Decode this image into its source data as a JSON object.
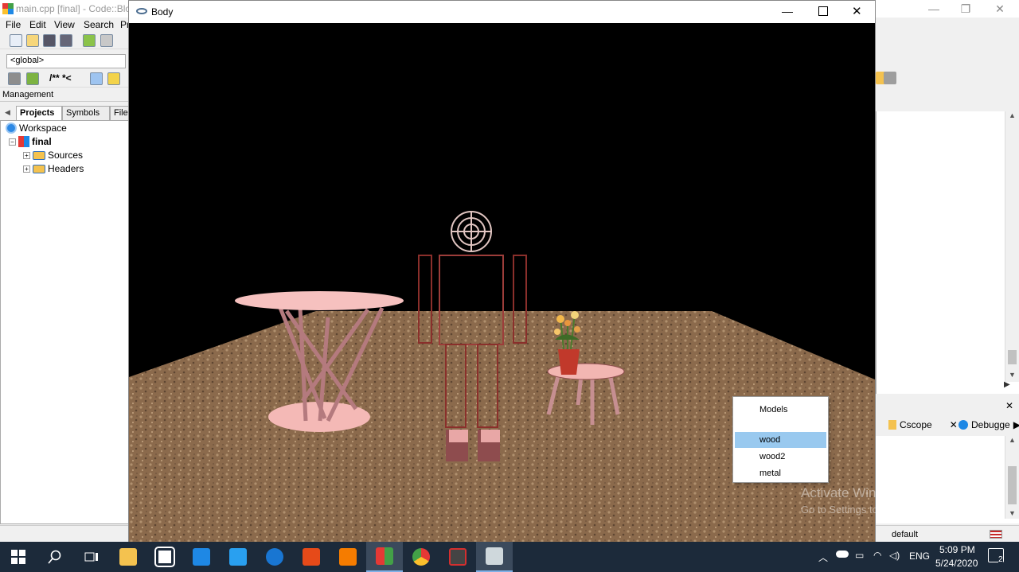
{
  "ide": {
    "title": "main.cpp [final] - Code::Blo",
    "menu": [
      "File",
      "Edit",
      "View",
      "Search",
      "Pr"
    ],
    "scope": "<global>",
    "comment_tools": "/** *<",
    "management_label": "Management",
    "tabs": [
      "Projects",
      "Symbols",
      "Files"
    ],
    "tree": {
      "workspace": "Workspace",
      "project": "final",
      "sources": "Sources",
      "headers": "Headers"
    },
    "log_tabs": [
      "Cscope",
      "Debugge"
    ],
    "status_profile": "default"
  },
  "body_window": {
    "title": "Body",
    "popup_menu": {
      "header": "Models",
      "items": [
        "wood",
        "wood2",
        "metal"
      ],
      "selected": "wood"
    }
  },
  "watermark": {
    "line1": "Activate Windows",
    "line2": "Go to Settings to activate Windows."
  },
  "taskbar": {
    "language": "ENG",
    "time": "5:09 PM",
    "date": "5/24/2020",
    "notification_count": "2"
  },
  "colors": {
    "floor": "#8b6a4c",
    "furniture": "#f2b6b2",
    "selection": "#99c9ef",
    "taskbar": "#1c2a3a"
  }
}
